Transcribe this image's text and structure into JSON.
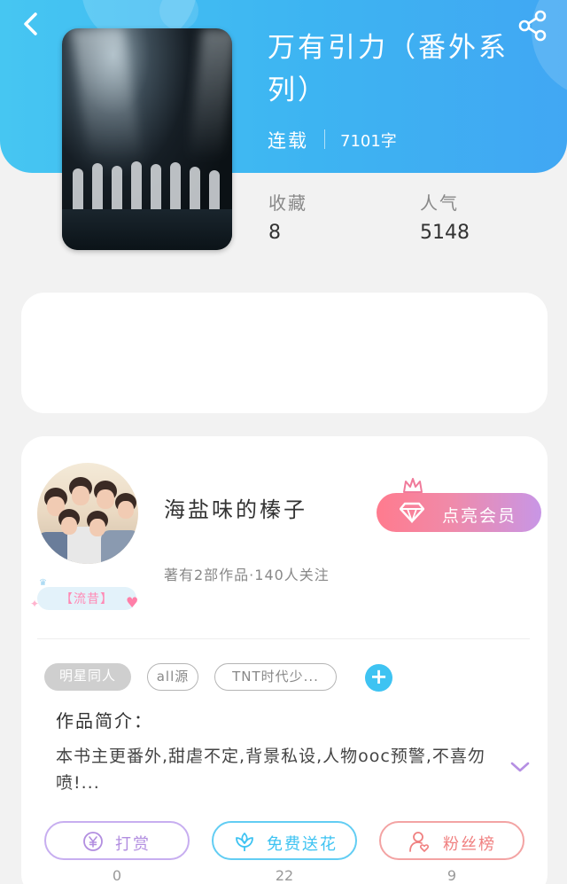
{
  "book": {
    "title": "万有引力（番外系列）",
    "status": "连载",
    "word_count": "7101字",
    "stats": [
      {
        "label": "收藏",
        "value": "8"
      },
      {
        "label": "人气",
        "value": "5148"
      }
    ]
  },
  "author": {
    "name": "海盐味的榛子",
    "meta": "著有2部作品·140人关注",
    "honor_tag": "【流昔】",
    "vip_button": "点亮会员"
  },
  "tags": [
    {
      "label": "明星同人",
      "style": "filled"
    },
    {
      "label": "all源",
      "style": "outlined"
    },
    {
      "label": "TNT时代少...",
      "style": "outlined"
    }
  ],
  "add_tag_icon": "plus-icon",
  "intro": {
    "title": "作品简介：",
    "text": "本书主更番外,甜虐不定,背景私设,人物ooc预警,不喜勿喷!..."
  },
  "actions": [
    {
      "label": "打赏",
      "count": "0",
      "icon": "yen-coin-icon",
      "color": "#b28ee0"
    },
    {
      "label": "免费送花",
      "count": "22",
      "icon": "flower-icon",
      "color": "#3ec3f2"
    },
    {
      "label": "粉丝榜",
      "count": "9",
      "icon": "user-heart-icon",
      "color": "#f08080"
    }
  ],
  "colors": {
    "header": "#3db4f2",
    "accent": "#3ec3f2",
    "vip_gradient": [
      "#ff7b8e",
      "#c896e6"
    ]
  }
}
